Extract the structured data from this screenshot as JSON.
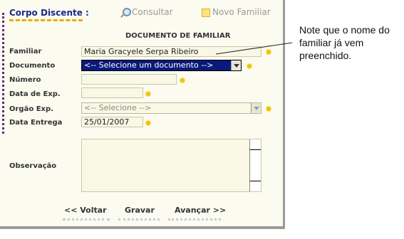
{
  "header": {
    "section_title": "Corpo Discente :",
    "consult_label": "Consultar",
    "new_family_label": "Novo Familiar"
  },
  "form": {
    "title": "DOCUMENTO DE FAMILIAR",
    "familiar_label": "Familiar",
    "familiar_value": "Maria Gracyele Serpa Ribeiro",
    "documento_label": "Documento",
    "documento_selected": "<-- Selecione um documento -->",
    "numero_label": "Número",
    "numero_value": "",
    "data_exp_label": "Data de Exp.",
    "data_exp_value": "",
    "orgao_label": "Orgão Exp.",
    "orgao_selected": "<-- Selecione -->",
    "data_entrega_label": "Data Entrega",
    "data_entrega_value": "25/01/2007",
    "observacao_label": "Observação"
  },
  "actions": {
    "back_label": "<< Voltar",
    "save_label": "Gravar",
    "next_label": "Avançar >>"
  },
  "callout": {
    "text": "Note que o nome do familiar já vem preenchido."
  },
  "colors": {
    "panel_bg": "#fbfbf0",
    "title_blue": "#1a2a8a",
    "accent_orange": "#f0a800",
    "select_highlight": "#0a1a7a",
    "required_marker": "#f2c200"
  }
}
